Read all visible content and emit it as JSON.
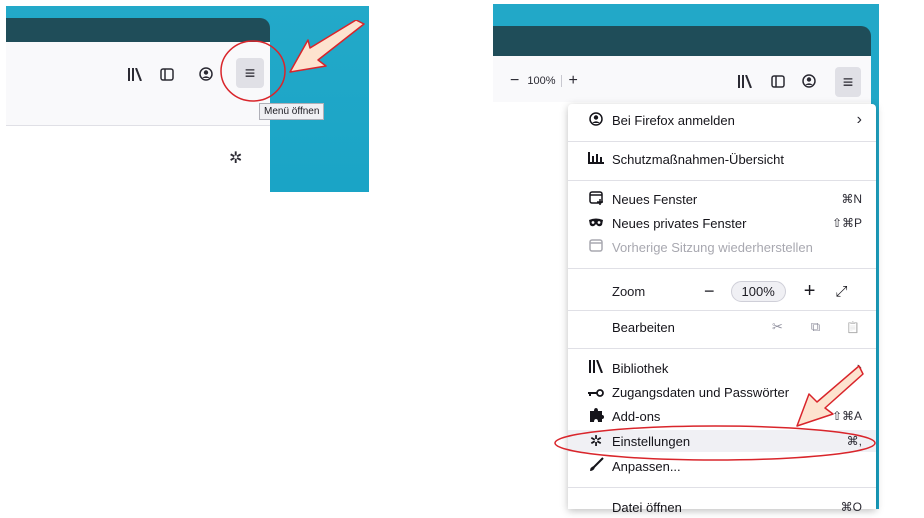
{
  "left_panel": {
    "toolbar_icons": [
      "library-icon",
      "sidebar-icon",
      "account-icon"
    ],
    "menu_button_glyph": "≡",
    "tooltip": "Menü öffnen",
    "settings_glyph": "✲"
  },
  "right_panel": {
    "zoom": {
      "minus": "−",
      "level": "100%",
      "plus": "+"
    },
    "menu_button_glyph": "≡"
  },
  "menu": {
    "sign_in": {
      "label": "Bei Firefox anmelden",
      "chevron": "›"
    },
    "protections": {
      "label": "Schutzmaßnahmen-Übersicht"
    },
    "new_window": {
      "label": "Neues Fenster",
      "shortcut": "⌘N"
    },
    "new_private": {
      "label": "Neues privates Fenster",
      "shortcut": "⇧⌘P"
    },
    "restore_session": {
      "label": "Vorherige Sitzung wiederherstellen"
    },
    "zoom": {
      "label": "Zoom",
      "minus": "−",
      "value": "100%",
      "plus": "+",
      "fullscreen": "⤢"
    },
    "edit": {
      "label": "Bearbeiten",
      "cut": "✂",
      "copy": "⧉",
      "paste": "📋"
    },
    "library": {
      "label": "Bibliothek",
      "chevron": "›"
    },
    "logins": {
      "label": "Zugangsdaten und Passwörter"
    },
    "addons": {
      "label": "Add-ons",
      "shortcut": "⇧⌘A"
    },
    "settings": {
      "label": "Einstellungen",
      "shortcut": "⌘,"
    },
    "customize": {
      "label": "Anpassen..."
    },
    "open_file": {
      "label": "Datei öffnen",
      "shortcut": "⌘O"
    }
  },
  "colors": {
    "background_teal": "#1aa4c6",
    "titlebar": "#1f4d59",
    "annotation_red": "#d9252b",
    "arrow_fill": "#fde3cf"
  }
}
